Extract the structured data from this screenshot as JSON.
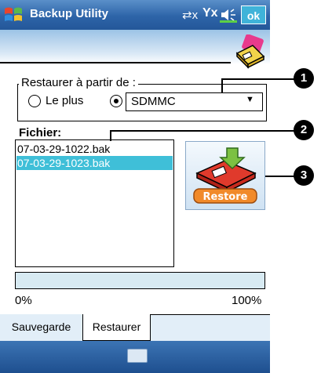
{
  "window": {
    "title": "Backup Utility",
    "ok_label": "ok"
  },
  "restore_from": {
    "label": "Restaurer à partir de :",
    "radio_le_plus_label": "Le plus",
    "selected_option": "SDMMC"
  },
  "file_list": {
    "label": "Fichier:",
    "items": [
      "07-03-29-1022.bak",
      "07-03-29-1023.bak"
    ],
    "selected_index": 1
  },
  "restore_button": {
    "label": "Restore"
  },
  "progress": {
    "value_percent": 0,
    "min_label": "0%",
    "max_label": "100%"
  },
  "tabs": [
    {
      "label": "Sauvegarde",
      "active": false
    },
    {
      "label": "Restaurer",
      "active": true
    }
  ],
  "callouts": [
    "1",
    "2",
    "3"
  ],
  "colors": {
    "titlebar": "#2d64a8",
    "selection": "#3fbfd8",
    "progress_track": "#d7eaf2"
  }
}
